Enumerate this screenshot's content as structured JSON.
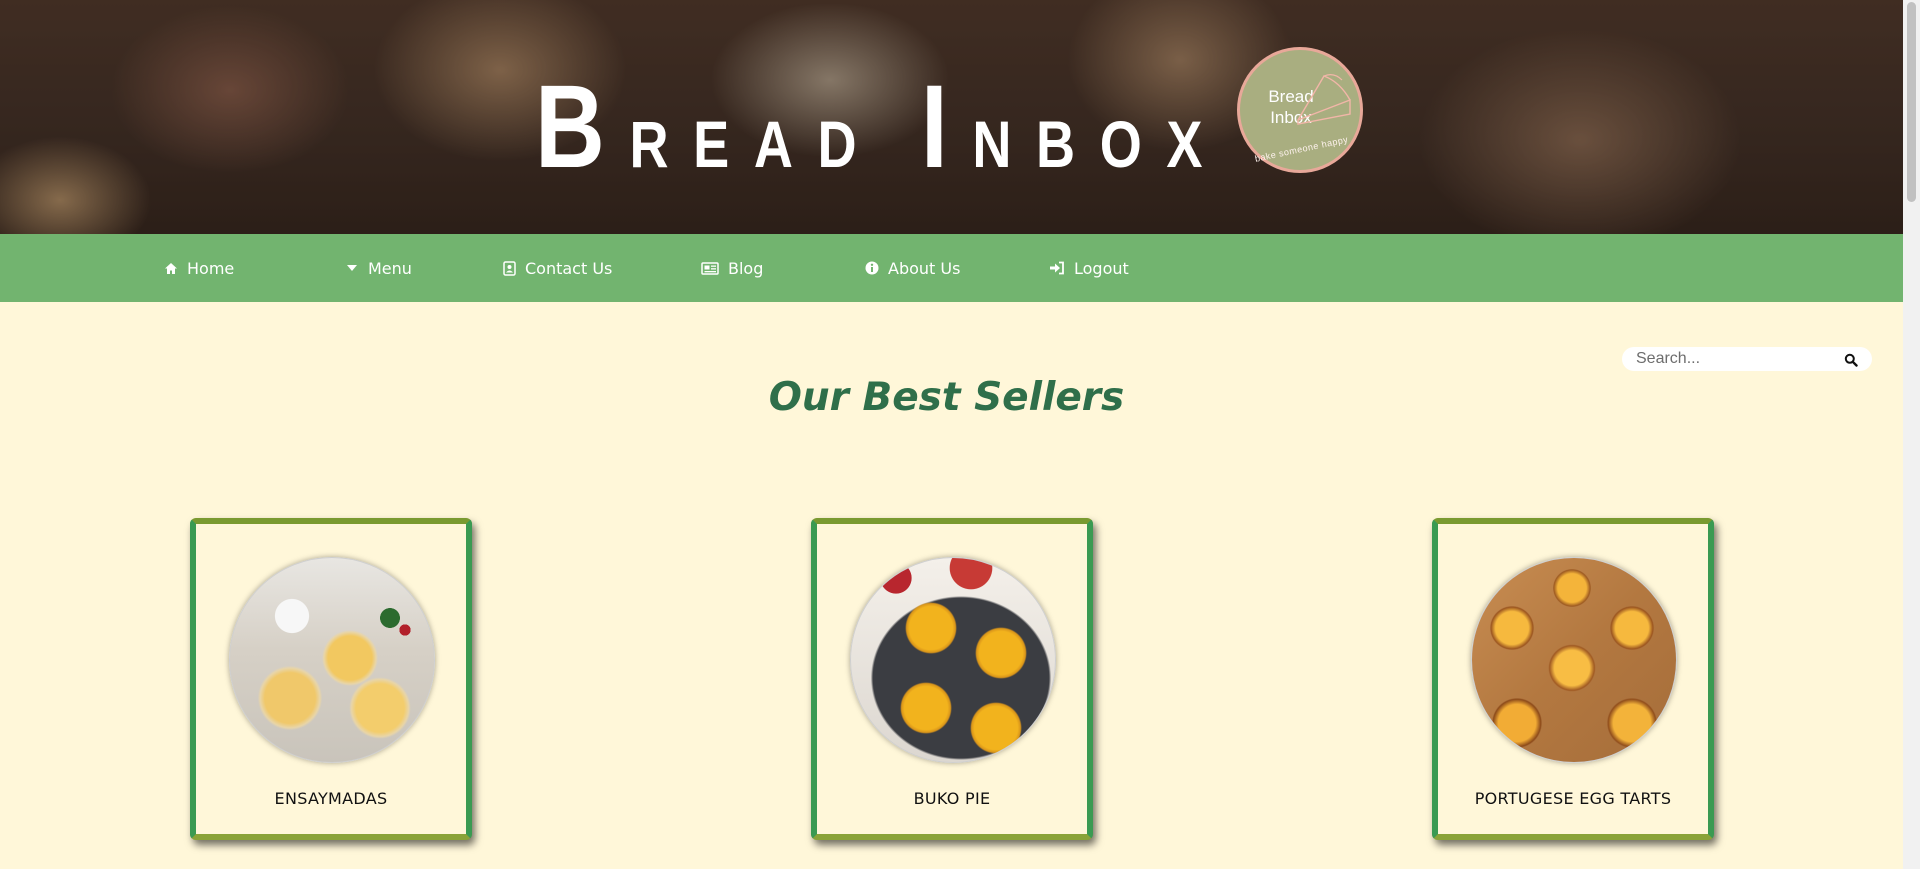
{
  "header": {
    "title_initial_1": "B",
    "title_rest_1": "READ ",
    "title_initial_2": "I",
    "title_rest_2": "NBOX",
    "logo_text": "Bread\nInbox",
    "logo_tagline": "bake someone happy"
  },
  "nav": {
    "items": [
      {
        "label": "Home",
        "icon": "home-icon"
      },
      {
        "label": "Menu",
        "icon": "caret-down-icon"
      },
      {
        "label": "Contact Us",
        "icon": "contact-book-icon"
      },
      {
        "label": "Blog",
        "icon": "newspaper-icon"
      },
      {
        "label": "About Us",
        "icon": "info-icon"
      },
      {
        "label": "Logout",
        "icon": "sign-in-icon"
      }
    ]
  },
  "search": {
    "placeholder": "Search...",
    "icon": "search-icon"
  },
  "main": {
    "title": "Our Best Sellers",
    "products": [
      {
        "name": "ENSAYMADAS"
      },
      {
        "name": "BUKO PIE"
      },
      {
        "name": "PORTUGESE EGG TARTS"
      }
    ]
  },
  "colors": {
    "nav_bg": "#72b46f",
    "page_bg": "#fff7d9",
    "title_green": "#2f6f4a",
    "card_border": "#3a9a52",
    "logo_bg": "#a9ae80",
    "logo_ring": "#e8a899"
  }
}
